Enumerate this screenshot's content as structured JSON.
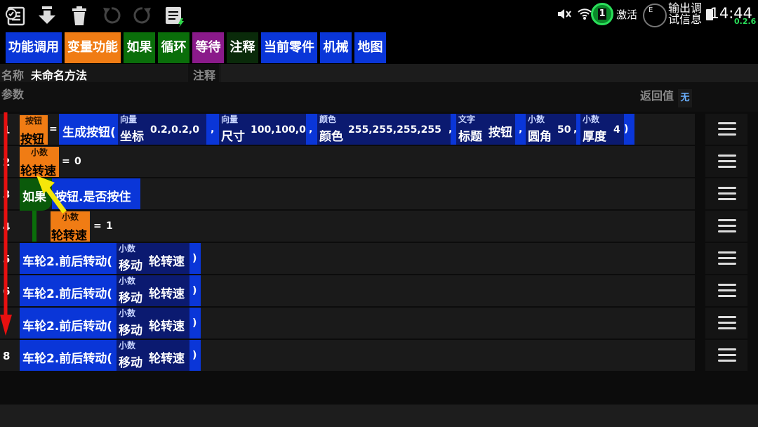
{
  "toolbar": {
    "icons": [
      "list-icon",
      "download-icon",
      "trash-icon",
      "undo-icon",
      "redo-icon",
      "doc-icon"
    ]
  },
  "status": {
    "sim_label": "1",
    "activate": "激活",
    "e_badge": "E",
    "notice_top": "输出调",
    "notice_bottom": "试信息",
    "time": "14:44",
    "version": "0.2.6"
  },
  "tabs": [
    {
      "label": "功能调用",
      "color": "#0a36d8"
    },
    {
      "label": "变量功能",
      "color": "#f07c14"
    },
    {
      "label": "如果",
      "color": "#0a6e0a"
    },
    {
      "label": "循环",
      "color": "#0a6e0a"
    },
    {
      "label": "等待",
      "color": "#8a1a8a"
    },
    {
      "label": "注释",
      "color": "#0a2a0a"
    },
    {
      "label": "当前零件",
      "color": "#0a36d8"
    },
    {
      "label": "机械",
      "color": "#0a36d8"
    },
    {
      "label": "地图",
      "color": "#0a36d8"
    }
  ],
  "method": {
    "name_label": "名称",
    "name_value": "未命名方法",
    "comment_label": "注释",
    "params_label": "参数",
    "return_label": "返回值",
    "return_value": "无"
  },
  "rows": {
    "line_numbers": [
      "1",
      "2",
      "3",
      "4",
      "5",
      "6",
      "7",
      "8"
    ],
    "r1": {
      "var_type": "按钮",
      "var_name": "按钮",
      "eq": "=",
      "func": "生成按钮(",
      "p1_type": "向量",
      "p1_name": "坐标",
      "p1_val": "0.2,0.2,0",
      "comma": ",",
      "p2_type": "向量",
      "p2_name": "尺寸",
      "p2_val": "100,100,0",
      "p3_type": "颜色",
      "p3_name": "颜色",
      "p3_val": "255,255,255,255",
      "p4_type": "文字",
      "p4_name": "标题",
      "p4_val": "按钮",
      "p5_type": "小数",
      "p5_name": "圆角",
      "p5_val": "50",
      "p6_type": "小数",
      "p6_name": "厚度",
      "p6_val": "4",
      "close": ")"
    },
    "r2": {
      "var_type": "小数",
      "var_name": "轮转速",
      "eq": "=",
      "val": "0"
    },
    "r3": {
      "keyword": "如果",
      "cond": "按钮.是否按住"
    },
    "r4": {
      "var_type": "小数",
      "var_name": "轮转速",
      "eq": "=",
      "val": "1"
    },
    "motor": {
      "func": "车轮2.前后转动(",
      "p_type": "小数",
      "p_name": "移动",
      "p_val": "轮转速",
      "close": ")"
    }
  },
  "colors": {
    "block_blue": "#0a36d8",
    "param_navy": "#0b1a70",
    "var_orange": "#f07c14",
    "if_green": "#0a5a0a",
    "arrow_red": "#e81010",
    "arrow_yellow": "#f5e60a"
  }
}
